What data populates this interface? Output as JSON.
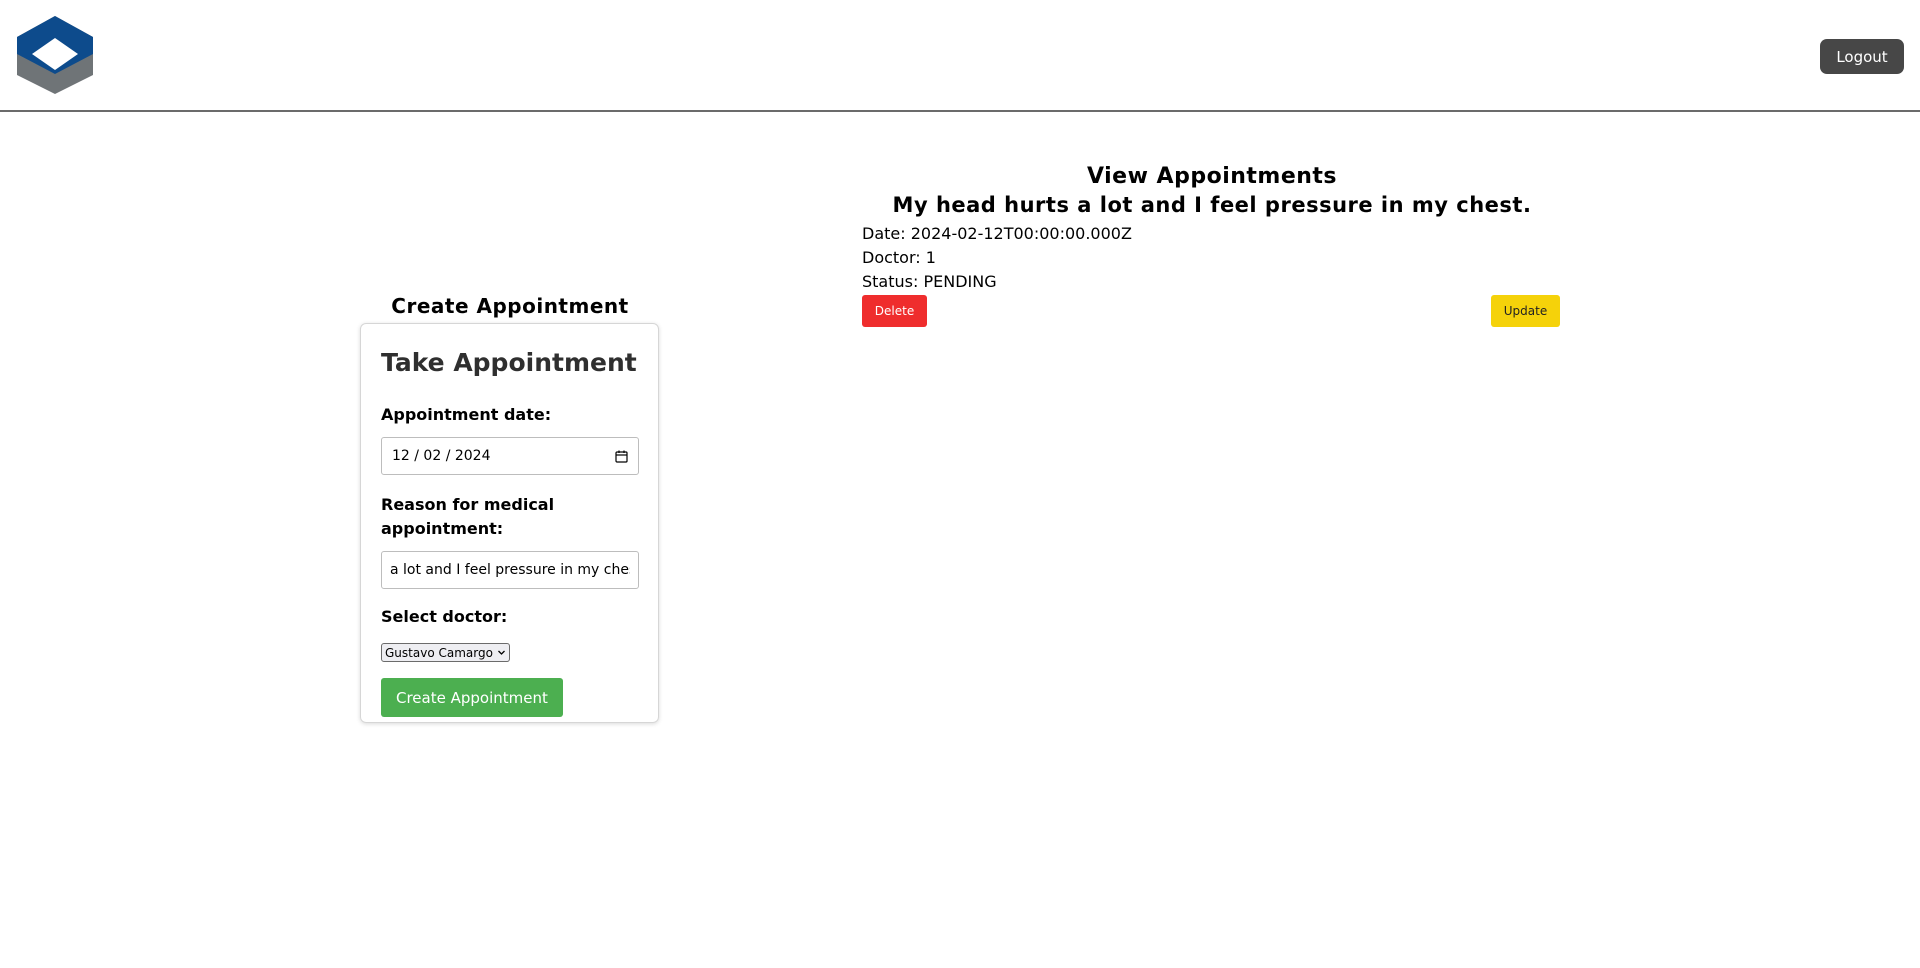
{
  "header": {
    "logo_icon": "hexagon-cube-logo",
    "logout_label": "Logout",
    "colors": {
      "logo_top": "#0d4b8c",
      "logo_bottom": "#6f7477",
      "logout_bg": "#474747"
    }
  },
  "create_section": {
    "title": "Create Appointment",
    "form": {
      "title": "Take Appointment",
      "date_label": "Appointment date:",
      "date_value": "12 / 02 / 2024",
      "date_icon": "calendar-icon",
      "reason_label": "Reason for medical appointment:",
      "reason_value": "a lot and I feel pressure in my chest.",
      "doctor_label": "Select doctor:",
      "doctor_selected": "Gustavo Camargo",
      "doctor_icon": "chevron-down-icon",
      "submit_label": "Create Appointment",
      "submit_color": "#4caf50"
    }
  },
  "view_section": {
    "title": "View Appointments",
    "appointments": [
      {
        "reason": "My head hurts a lot and I feel pressure in my chest.",
        "date_line": "Date: 2024-02-12T00:00:00.000Z",
        "doctor_line": "Doctor: 1",
        "status_line": "Status: PENDING",
        "delete_label": "Delete",
        "update_label": "Update",
        "delete_color": "#ef2d2d",
        "update_color": "#f5d20a"
      }
    ]
  }
}
